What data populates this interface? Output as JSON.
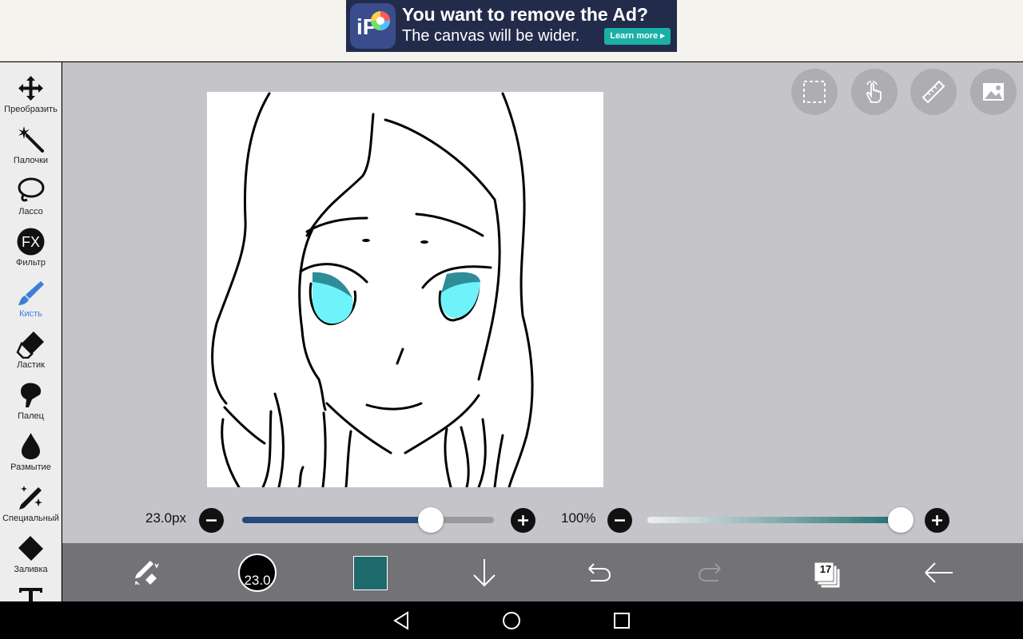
{
  "ad": {
    "logo_text": "iP",
    "title": "You want to remove the Ad?",
    "subtitle": "The canvas will be wider.",
    "button": "Learn more ▸"
  },
  "tools": [
    {
      "label": "Преобразить",
      "icon": "move-arrows-icon"
    },
    {
      "label": "Палочки",
      "icon": "magic-wand-icon"
    },
    {
      "label": "Лассо",
      "icon": "lasso-icon"
    },
    {
      "label": "Фильтр",
      "icon": "fx-icon"
    },
    {
      "label": "Кисть",
      "icon": "brush-icon",
      "active": true
    },
    {
      "label": "Ластик",
      "icon": "eraser-icon"
    },
    {
      "label": "Палец",
      "icon": "finger-icon"
    },
    {
      "label": "Размытие",
      "icon": "blur-drop-icon"
    },
    {
      "label": "Специальный",
      "icon": "special-pen-icon"
    },
    {
      "label": "Заливка",
      "icon": "bucket-fill-icon"
    },
    {
      "label": "",
      "icon": "text-tool-icon"
    }
  ],
  "quick_tools": [
    "selection-icon",
    "hand-gesture-icon",
    "ruler-icon",
    "image-icon"
  ],
  "brush": {
    "size_label": "23.0px",
    "size_fraction": 0.75,
    "opacity_label": "100%",
    "opacity_fraction": 1.0,
    "circle_label": "23.0"
  },
  "toolbar": {
    "layers_count": "17",
    "current_color": "#1d6b6d"
  },
  "colors": {
    "accent": "#3b7fd9",
    "eye_fill": "#6ef3fa",
    "eye_shadow": "#2e8d98",
    "slider_fill": "#234a7a"
  }
}
